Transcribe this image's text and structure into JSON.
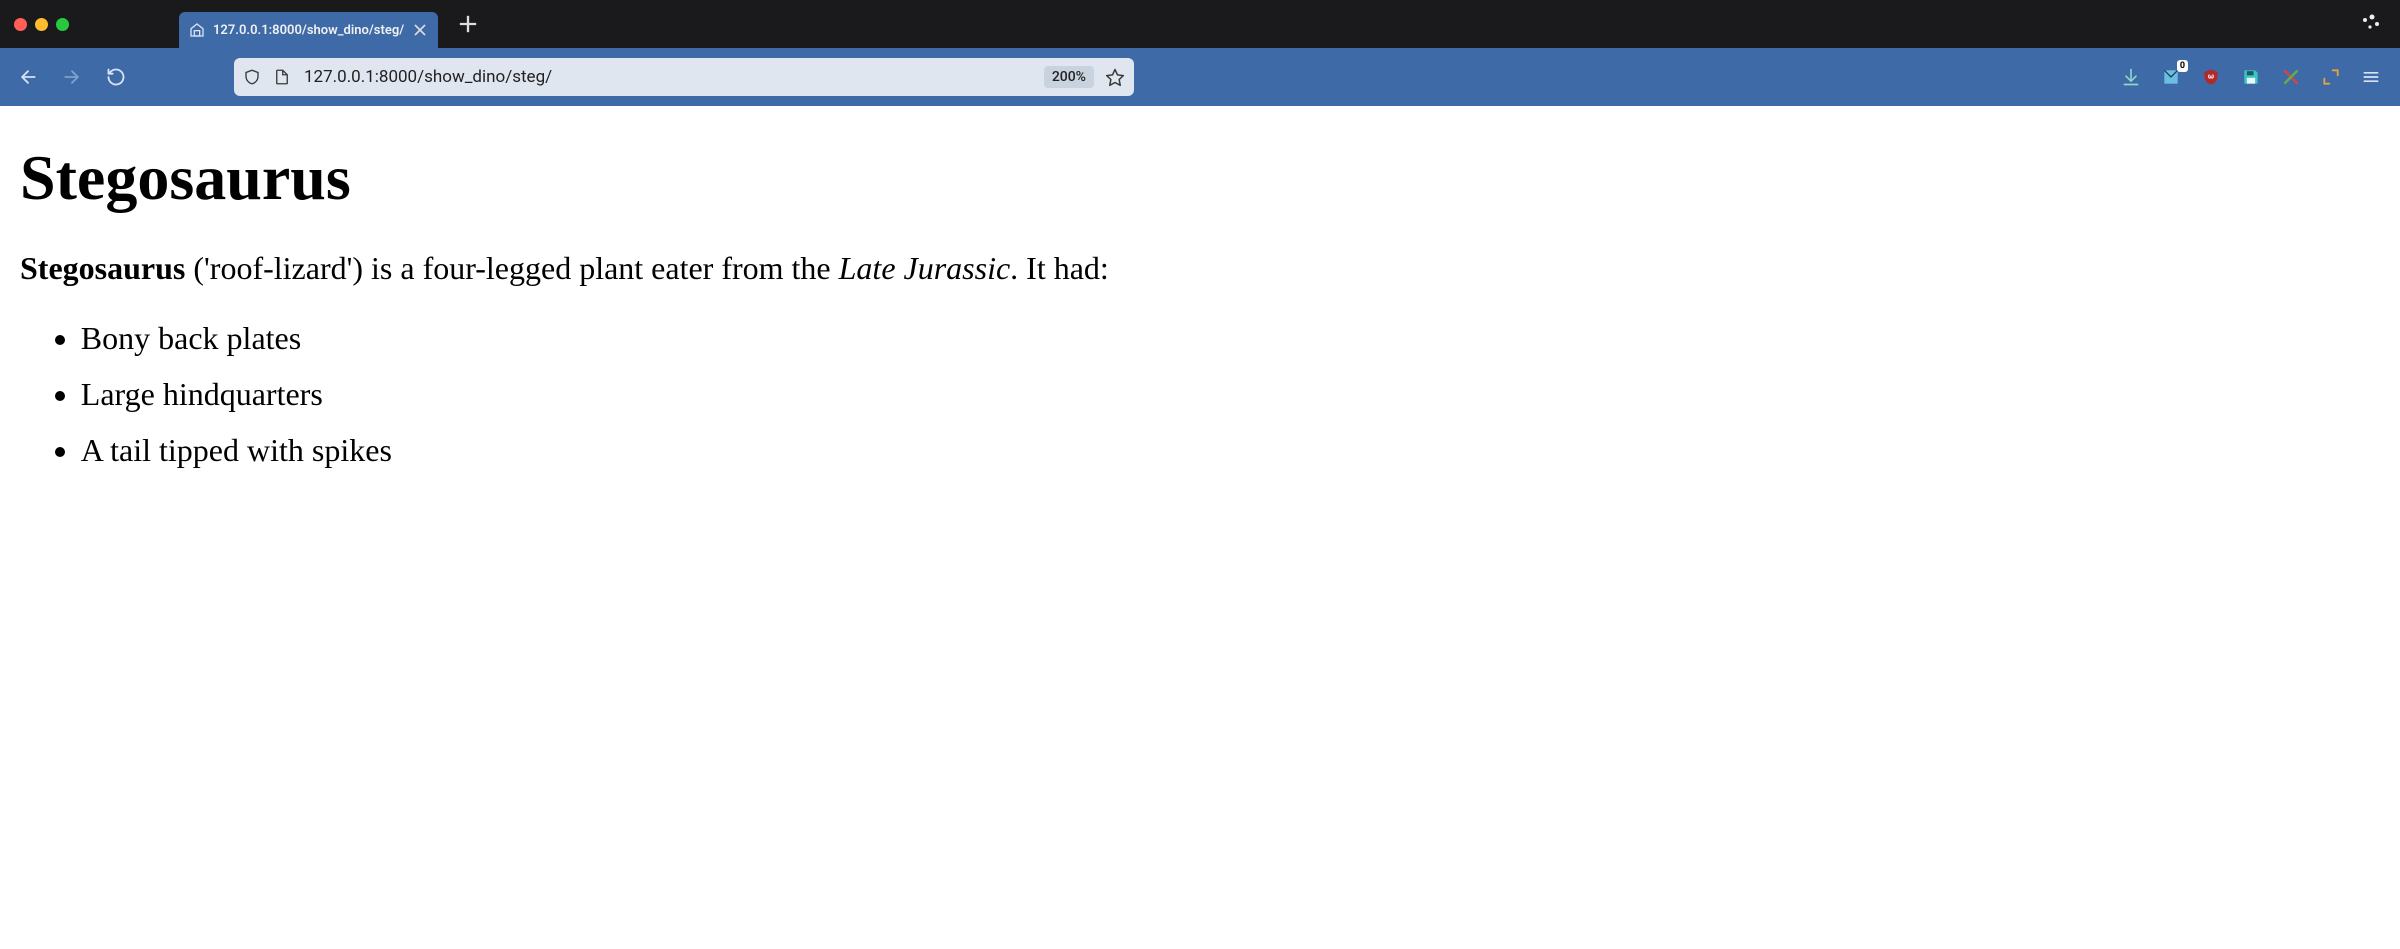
{
  "window": {
    "tab_title": "127.0.0.1:8000/show_dino/steg/"
  },
  "toolbar": {
    "url": "127.0.0.1:8000/show_dino/steg/",
    "zoom": "200%",
    "download_badge": "0"
  },
  "page": {
    "heading": "Stegosaurus",
    "intro": {
      "bold": "Stegosaurus",
      "mid1": " ('roof-lizard') is a four-legged plant eater from the ",
      "italic": "Late Jurassic",
      "tail": ". It had:"
    },
    "features": [
      "Bony back plates",
      "Large hindquarters",
      "A tail tipped with spikes"
    ]
  }
}
